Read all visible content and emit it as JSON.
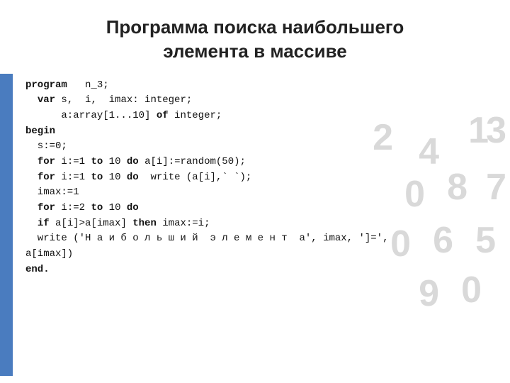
{
  "header": {
    "title_line1": "Программа поиска наибольшего",
    "title_line2": "элемента в массиве"
  },
  "code": {
    "lines": [
      "program   n_3;",
      "  var s,  i,  imax: integer;",
      "      a:array[1...10] of integer;",
      "begin",
      "  s:=0;",
      "  for i:=1 to 10 do a[i]:=random(50);",
      "  for i:=1 to 10 do  write (a[i],` `);",
      "  imax:=1",
      "  for i:=2 to 10 do",
      "  if a[i]>a[imax] then imax:=i;",
      "  write (‘Наибольший  элемент  a’, imax, ’]=’,",
      "a[imax])",
      "end."
    ]
  },
  "decoration": {
    "numbers": [
      "1",
      "4",
      "2",
      "3",
      "0",
      "8",
      "7",
      "0",
      "6",
      "5",
      "9",
      "0"
    ]
  }
}
